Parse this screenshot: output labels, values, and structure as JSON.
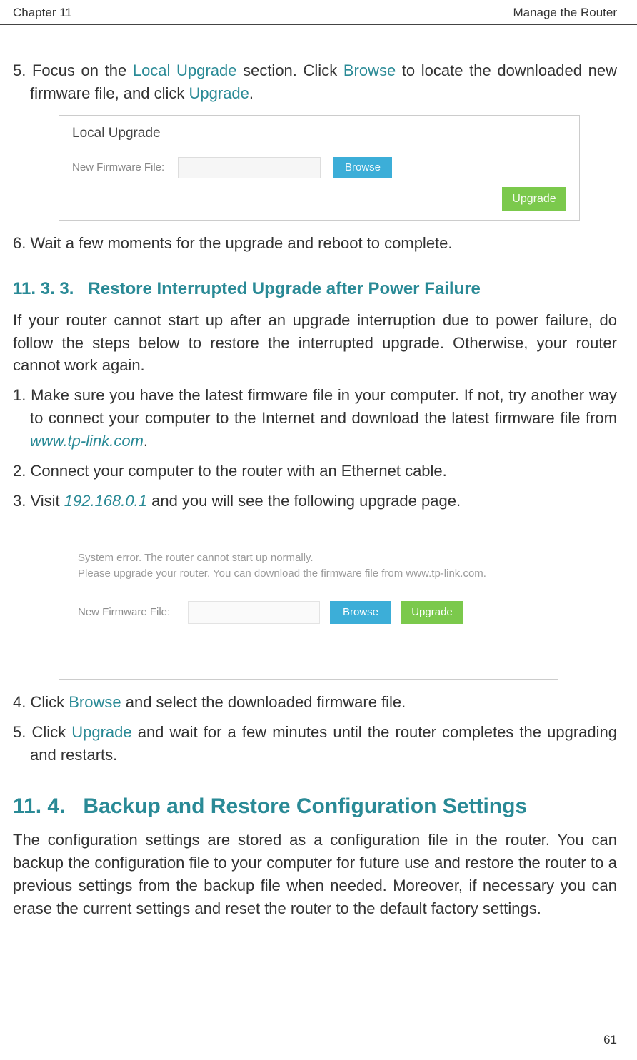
{
  "header": {
    "left": "Chapter 11",
    "right": "Manage the Router"
  },
  "step5_pre": "5. Focus on the ",
  "step5_link1": "Local Upgrade",
  "step5_mid1": " section. Click ",
  "step5_link2": "Browse",
  "step5_mid2": " to locate the downloaded new firmware file, and click ",
  "step5_link3": "Upgrade",
  "step5_end": ".",
  "fig1": {
    "title": "Local Upgrade",
    "label": "New Firmware File:",
    "browse": "Browse",
    "upgrade": "Upgrade"
  },
  "step6": "6. Wait a few moments for the upgrade and reboot to complete.",
  "sub1_num": "11. 3. 3.",
  "sub1_txt": "Restore Interrupted Upgrade after Power Failure",
  "para1": "If your router cannot start up after an upgrade interruption due to power failure, do follow the steps below to restore the interrupted upgrade. Otherwise, your router cannot work again.",
  "s1_pre": "1. Make sure you have the latest firmware file in your computer. If not, try another way to connect your computer to the Internet and download the latest firmware file from ",
  "s1_link": "www.tp-link.com",
  "s1_end": ".",
  "s2": "2. Connect your computer to the router with an Ethernet cable.",
  "s3_pre": "3. Visit ",
  "s3_link": "192.168.0.1",
  "s3_end": " and you will see the following upgrade page.",
  "fig2": {
    "err1": "System error. The router cannot start up normally.",
    "err2": "Please upgrade your router. You can download the firmware file from www.tp-link.com.",
    "label": "New Firmware File:",
    "browse": "Browse",
    "upgrade": "Upgrade"
  },
  "s4_pre": "4. Click ",
  "s4_link": "Browse",
  "s4_end": " and select the downloaded firmware file.",
  "s5_pre": "5. Click ",
  "s5_link": "Upgrade",
  "s5_end": " and wait for a few minutes until the router completes the upgrading and restarts.",
  "head2_num": "11. 4.",
  "head2_txt": "Backup and Restore Configuration Settings",
  "para2": "The configuration settings are stored as a configuration file in the router. You can backup the configuration file to your computer for future use and restore the router to a previous settings from the backup file when needed. Moreover, if necessary you can erase the current settings and reset the router to the default factory settings.",
  "page_num": "61"
}
